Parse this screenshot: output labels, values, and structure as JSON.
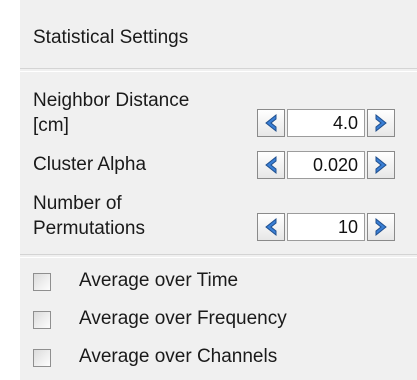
{
  "panel": {
    "title": "Statistical Settings"
  },
  "params": [
    {
      "label_line1": "Neighbor Distance",
      "label_line2": "[cm]",
      "value": "4.0"
    },
    {
      "label": "Cluster Alpha",
      "value": "0.020"
    },
    {
      "label_line1": "Number of",
      "label_line2": "Permutations",
      "value": "10"
    }
  ],
  "options": [
    {
      "label": "Average over Time",
      "checked": false
    },
    {
      "label": "Average over Frequency",
      "checked": false
    },
    {
      "label": "Average over Channels",
      "checked": false
    }
  ],
  "icons": {
    "decrement": "chevron-left-icon",
    "increment": "chevron-right-icon"
  },
  "colors": {
    "panel_background": "#f0f0f0",
    "arrow_fill": "#3a7fd5",
    "arrow_outline": "#1f4f8e"
  }
}
